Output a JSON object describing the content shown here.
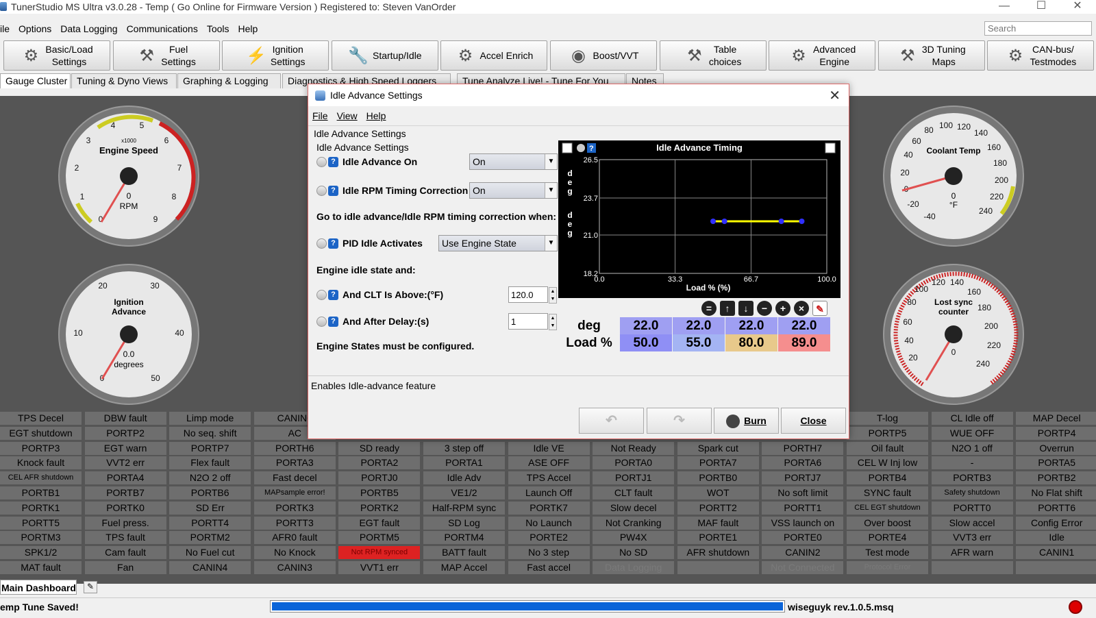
{
  "window": {
    "title": "TunerStudio MS Ultra v3.0.28 - Temp ( Go Online for Firmware Version ) Registered to: Steven VanOrder"
  },
  "menu": [
    "ile",
    "Options",
    "Data Logging",
    "Communications",
    "Tools",
    "Help"
  ],
  "search": {
    "placeholder": "Search"
  },
  "toolbar": [
    {
      "label": "Basic/Load\nSettings",
      "icon": "gear-icon"
    },
    {
      "label": "Fuel\nSettings",
      "icon": "injector-icon"
    },
    {
      "label": "Ignition\nSettings",
      "icon": "spark-plug-icon"
    },
    {
      "label": "Startup/Idle",
      "icon": "wrench-icon"
    },
    {
      "label": "Accel Enrich",
      "icon": "accel-icon"
    },
    {
      "label": "Boost/VVT",
      "icon": "turbo-icon"
    },
    {
      "label": "Table\nchoices",
      "icon": "tools-icon"
    },
    {
      "label": "Advanced\nEngine",
      "icon": "gears-icon"
    },
    {
      "label": "3D Tuning\nMaps",
      "icon": "hammer-icon"
    },
    {
      "label": "CAN-bus/\nTestmodes",
      "icon": "gear-icon"
    }
  ],
  "tabs": [
    "Gauge Cluster",
    "Tuning & Dyno Views",
    "Graphing & Logging",
    "Diagnostics & High Speed Loggers",
    "Tune Analyze Live! - Tune For You",
    "Notes"
  ],
  "gauges": {
    "rpm": {
      "title": "Engine Speed",
      "multiplier": "x1000",
      "unit": "RPM",
      "value": "0",
      "ticks": [
        "0",
        "1",
        "2",
        "3",
        "4",
        "5",
        "6",
        "7",
        "8",
        "9"
      ]
    },
    "ignition": {
      "title1": "Ignition",
      "title2": "Advance",
      "value": "0.0",
      "unit": "degrees",
      "ticks": [
        "0",
        "10",
        "20",
        "30",
        "40",
        "50"
      ]
    },
    "coolant": {
      "title": "Coolant Temp",
      "value": "0",
      "unit": "°F",
      "ticks": [
        "-40",
        "-20",
        "0",
        "20",
        "40",
        "60",
        "80",
        "100",
        "120",
        "140",
        "160",
        "180",
        "200",
        "220",
        "240"
      ]
    },
    "lostsync": {
      "title1": "Lost sync",
      "title2": "counter",
      "value": "0",
      "ticks": [
        "0",
        "20",
        "40",
        "60",
        "80",
        "100",
        "120",
        "140",
        "160",
        "180",
        "200",
        "220",
        "240"
      ]
    }
  },
  "indicators": [
    [
      "TPS Decel",
      "DBW fault",
      "Limp mode",
      "CANIN6",
      "",
      "",
      "",
      "",
      "",
      "",
      "T-log",
      "CL Idle off",
      "MAP Decel"
    ],
    [
      "EGT shutdown",
      "PORTP2",
      "No seq. shift",
      "AC",
      "",
      "",
      "",
      "",
      "",
      "",
      "PORTP5",
      "WUE OFF",
      "PORTP4"
    ],
    [
      "PORTP3",
      "EGT warn",
      "PORTP7",
      "PORTH6",
      "SD ready",
      "3 step off",
      "Idle VE",
      "Not Ready",
      "Spark cut",
      "PORTH7",
      "Oil fault",
      "N2O 1 off",
      "Overrun"
    ],
    [
      "Knock fault",
      "VVT2 err",
      "Flex fault",
      "PORTA3",
      "PORTA2",
      "PORTA1",
      "ASE OFF",
      "PORTA0",
      "PORTA7",
      "PORTA6",
      "CEL W Inj low",
      "-",
      "PORTA5"
    ],
    [
      "CEL AFR shutdown",
      "PORTA4",
      "N2O 2 off",
      "Fast decel",
      "PORTJ0",
      "Idle Adv",
      "TPS Accel",
      "PORTJ1",
      "PORTB0",
      "PORTJ7",
      "PORTB4",
      "PORTB3",
      "PORTB2"
    ],
    [
      "PORTB1",
      "PORTB7",
      "PORTB6",
      "MAPsample error!",
      "PORTB5",
      "VE1/2",
      "Launch Off",
      "CLT fault",
      "WOT",
      "No soft limit",
      "SYNC fault",
      "Safety shutdown",
      "No Flat shift"
    ],
    [
      "PORTK1",
      "PORTK0",
      "SD Err",
      "PORTK3",
      "PORTK2",
      "Half-RPM sync",
      "PORTK7",
      "Slow decel",
      "PORTT2",
      "PORTT1",
      "CEL EGT shutdown",
      "PORTT0",
      "PORTT6"
    ],
    [
      "PORTT5",
      "Fuel press.",
      "PORTT4",
      "PORTT3",
      "EGT fault",
      "SD Log",
      "No Launch",
      "Not Cranking",
      "MAF fault",
      "VSS launch on",
      "Over boost",
      "Slow accel",
      "Config Error"
    ],
    [
      "PORTM3",
      "TPS fault",
      "PORTM2",
      "AFR0 fault",
      "PORTM5",
      "PORTM4",
      "PORTE2",
      "PW4X",
      "PORTE1",
      "PORTE0",
      "PORTE4",
      "VVT3 err",
      "Idle"
    ],
    [
      "SPK1/2",
      "Cam fault",
      "No Fuel cut",
      "No Knock",
      "Not RPM synced",
      "BATT fault",
      "No 3 step",
      "No SD",
      "AFR shutdown",
      "CANIN2",
      "Test mode",
      "AFR warn",
      "CANIN1"
    ],
    [
      "MAT fault",
      "Fan",
      "CANIN4",
      "CANIN3",
      "VVT1 err",
      "MAP Accel",
      "Fast accel",
      "Data Logging",
      "",
      "Not Connected",
      "Protocol Error",
      "",
      ""
    ]
  ],
  "dashboard_tab": "Main Dashboard",
  "status": {
    "message": "emp Tune Saved!",
    "file": "wiseguyk rev.1.0.5.msq",
    "progress": 1.0
  },
  "dialog": {
    "title": "Idle Advance Settings",
    "menu": [
      "File",
      "View",
      "Help"
    ],
    "outer_group": "Idle Advance Settings",
    "inner_group": "Idle Advance Settings",
    "fields": {
      "idle_advance_on": {
        "label": "Idle Advance On",
        "value": "On"
      },
      "idle_rpm_timing": {
        "label": "Idle RPM Timing Correction",
        "value": "On"
      },
      "goto_text": "Go to idle advance/Idle RPM timing correction when:",
      "pid_idle": {
        "label": "PID Idle Activates",
        "value": "Use Engine State"
      },
      "engine_idle_text": "Engine idle state and:",
      "clt_above": {
        "label": "And CLT Is Above:(°F)",
        "value": "120.0"
      },
      "after_delay": {
        "label": "And After Delay:(s)",
        "value": "1"
      },
      "states_text": "Engine States must be configured."
    },
    "help_text": "Enables Idle-advance feature",
    "buttons": {
      "burn": "Burn",
      "close": "Close"
    }
  },
  "chart_data": {
    "type": "line",
    "title": "Idle Advance Timing",
    "xlabel": "Load % (%)",
    "ylabel": "deg",
    "x": [
      50.0,
      55.0,
      80.0,
      89.0
    ],
    "series": [
      {
        "values": [
          22.0,
          22.0,
          22.0,
          22.0
        ],
        "color": "#ffff00",
        "point_color": "#3030ff"
      }
    ],
    "xlim": [
      0.0,
      100.0
    ],
    "ylim": [
      18.2,
      26.5
    ],
    "xticks": [
      "0.0",
      "33.3",
      "66.7",
      "100.0"
    ],
    "yticks": [
      "26.5",
      "23.7",
      "21.0",
      "18.2"
    ],
    "grid": true,
    "table": {
      "row_labels": [
        "deg",
        "Load %"
      ],
      "deg": [
        "22.0",
        "22.0",
        "22.0",
        "22.0"
      ],
      "load": [
        "50.0",
        "55.0",
        "80.0",
        "89.0"
      ],
      "cell_colors": [
        "#8f8ff5",
        "#a4b4f3",
        "#e8c98b",
        "#f58e8e"
      ]
    }
  }
}
